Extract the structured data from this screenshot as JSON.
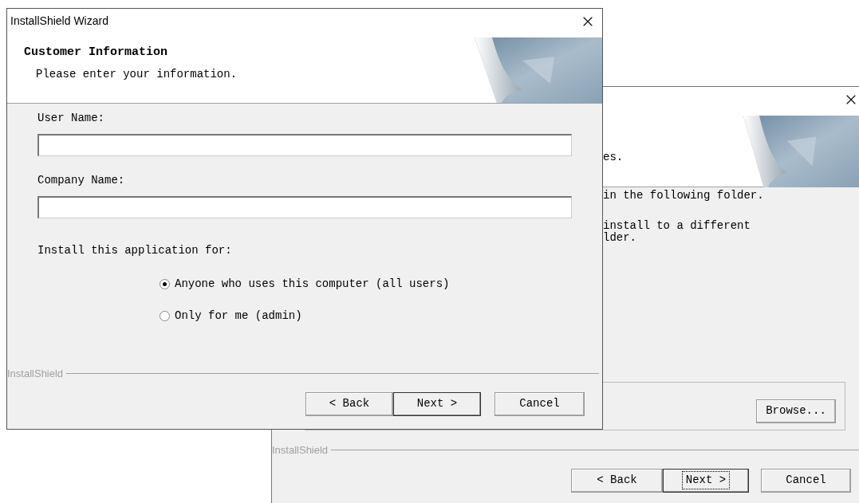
{
  "back_window": {
    "header_text": "es.",
    "body_lines": [
      "in the following folder.",
      "install to a different",
      "lder."
    ],
    "folder_button": "Browse...",
    "footer": {
      "brand": "InstallShield"
    },
    "buttons": [
      {
        "label": "< Back",
        "default": false,
        "focused": false
      },
      {
        "label": "Next >",
        "default": true,
        "focused": true
      },
      {
        "label": "Cancel",
        "default": false,
        "focused": false
      }
    ]
  },
  "front_window": {
    "title": "InstallShield Wizard",
    "header": {
      "title": "Customer Information",
      "subtitle": "Please enter your information."
    },
    "fields": [
      {
        "label": "User Name:"
      },
      {
        "label": "Company Name:"
      }
    ],
    "install_for": {
      "label": "Install this application for:",
      "options": [
        {
          "label": "Anyone who uses this computer (all users)",
          "selected": true
        },
        {
          "label": "Only for me (admin)",
          "selected": false
        }
      ]
    },
    "footer": {
      "brand": "InstallShield"
    },
    "buttons": [
      {
        "label": "< Back",
        "default": false,
        "focused": false
      },
      {
        "label": "Next >",
        "default": true,
        "focused": false
      },
      {
        "label": "Cancel",
        "default": false,
        "focused": false
      }
    ]
  }
}
